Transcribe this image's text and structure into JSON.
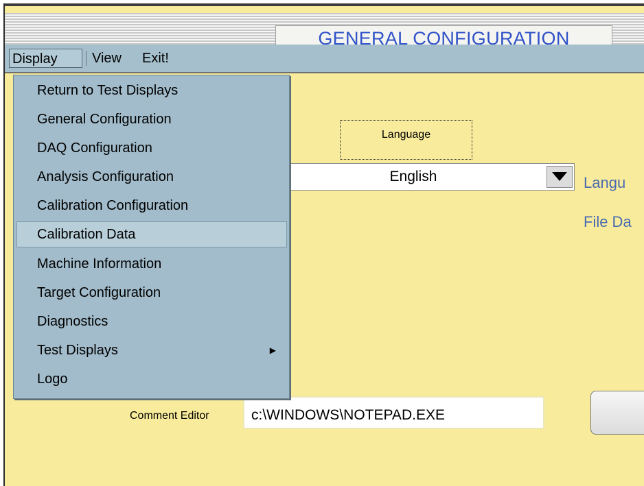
{
  "window": {
    "title": "GENERAL CONFIGURATION"
  },
  "menubar": {
    "items": [
      {
        "label": "Display"
      },
      {
        "label": "View"
      },
      {
        "label": "Exit!"
      }
    ]
  },
  "display_menu": {
    "items": [
      {
        "label": "Return to Test Displays"
      },
      {
        "label": "General Configuration"
      },
      {
        "label": "DAQ Configuration"
      },
      {
        "label": "Analysis Configuration"
      },
      {
        "label": "Calibration Configuration"
      },
      {
        "label": "Calibration Data",
        "highlighted": true
      },
      {
        "label": "Machine Information"
      },
      {
        "label": "Target Configuration"
      },
      {
        "label": "Diagnostics"
      },
      {
        "label": "Test Displays",
        "has_submenu": true
      },
      {
        "label": "Logo"
      }
    ]
  },
  "language": {
    "group_label": "Language",
    "selected": "English"
  },
  "side_labels": {
    "first": "Langu",
    "second": "File Da"
  },
  "comment_editor": {
    "label": "Comment Editor",
    "value": "c:\\WINDOWS\\NOTEPAD.EXE"
  },
  "colors": {
    "background": "#f8ec9c",
    "menu": "#a2bccb",
    "title_text": "#2f52c8",
    "side_label_text": "#4a6ab0"
  }
}
